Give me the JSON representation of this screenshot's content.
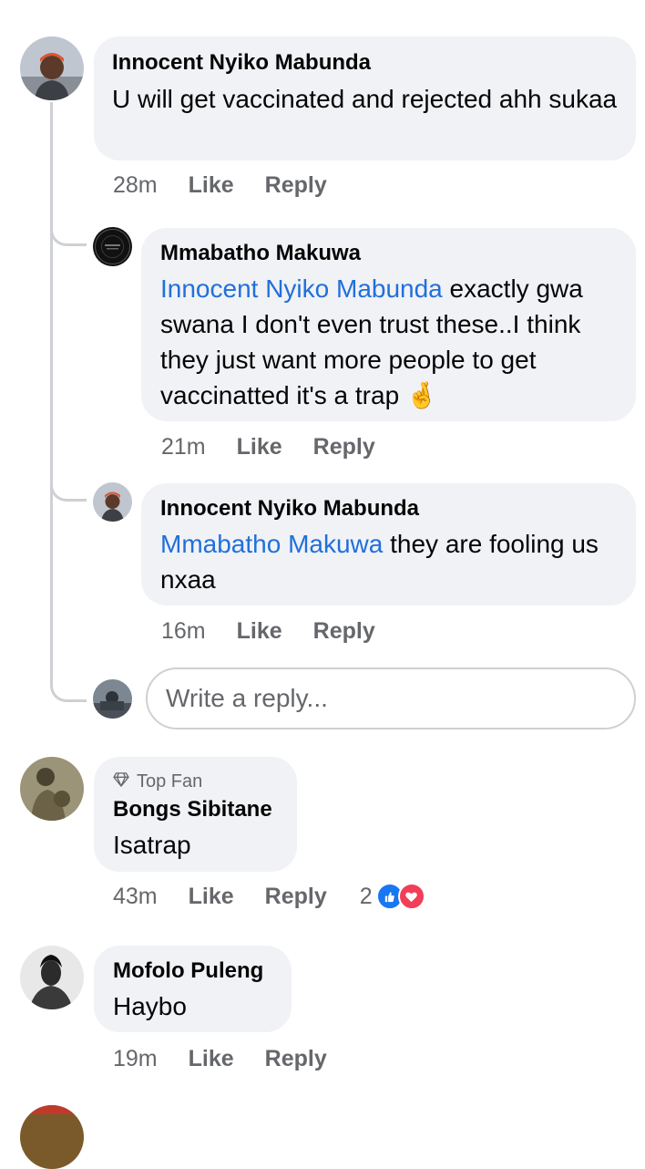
{
  "comments": [
    {
      "author": "Innocent Nyiko Mabunda",
      "text": "U will get vaccinated and rejected ahh sukaa",
      "time": "28m",
      "like": "Like",
      "reply": "Reply",
      "replies": [
        {
          "author": "Mmabatho Makuwa",
          "mention": "Innocent Nyiko Mabunda",
          "text": " exactly gwa swana I don't even trust these..I think they just want more people to get vaccinatted it's a trap 🤞",
          "time": "21m",
          "like": "Like",
          "reply": "Reply"
        },
        {
          "author": "Innocent Nyiko Mabunda",
          "mention": "Mmabatho Makuwa",
          "text": " they are fooling us nxaa",
          "time": "16m",
          "like": "Like",
          "reply": "Reply"
        }
      ],
      "reply_input_placeholder": "Write a reply..."
    },
    {
      "badge": "Top Fan",
      "author": "Bongs Sibitane",
      "text": "Isatrap",
      "time": "43m",
      "like": "Like",
      "reply": "Reply",
      "reaction_count": "2",
      "reactions": [
        "like-icon",
        "love-icon"
      ]
    },
    {
      "author": "Mofolo Puleng",
      "text": "Haybo",
      "time": "19m",
      "like": "Like",
      "reply": "Reply"
    }
  ],
  "colors": {
    "bubble": "#f0f2f5",
    "mention": "#216fdb",
    "meta": "#65676b",
    "like_blue": "#1877f2",
    "love_red": "#f33e58"
  }
}
